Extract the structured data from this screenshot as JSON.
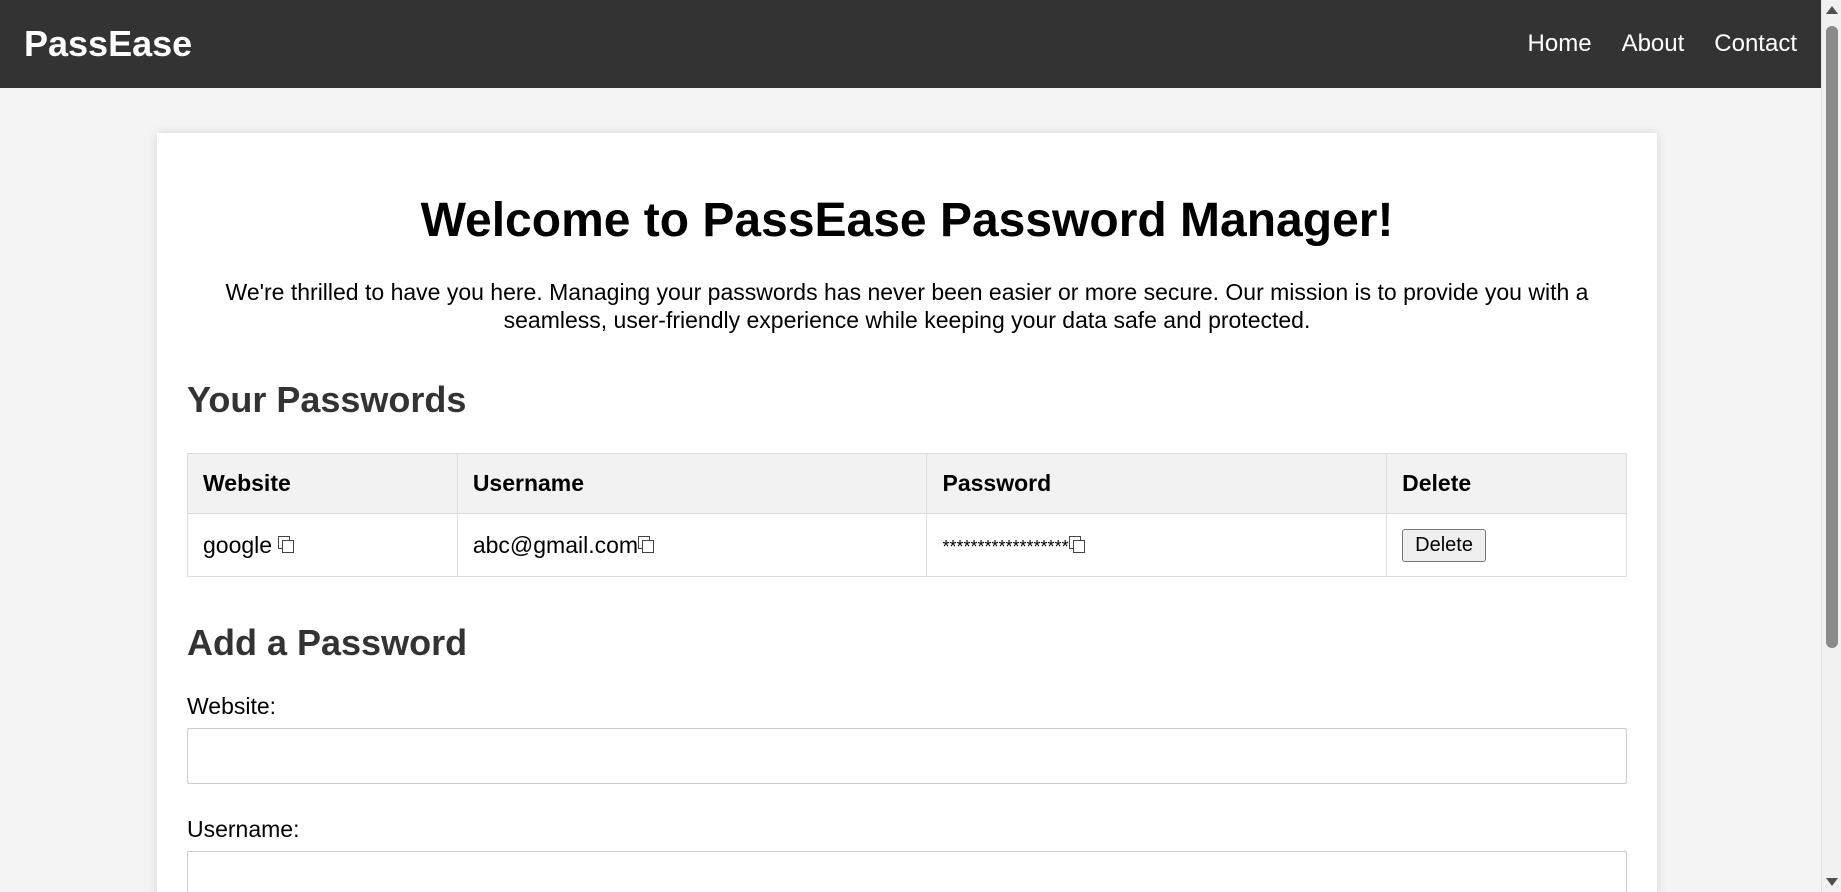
{
  "navbar": {
    "brand": "PassEase",
    "links": [
      "Home",
      "About",
      "Contact"
    ]
  },
  "welcome": {
    "title": "Welcome to PassEase Password Manager!",
    "text": "We're thrilled to have you here. Managing your passwords has never been easier or more secure. Our mission is to provide you with a seamless, user-friendly experience while keeping your data safe and protected."
  },
  "passwords": {
    "title": "Your Passwords",
    "columns": [
      "Website",
      "Username",
      "Password",
      "Delete"
    ],
    "rows": [
      {
        "website": "google",
        "username": "abc@gmail.com",
        "password": "******************",
        "delete_label": "Delete"
      }
    ]
  },
  "add_form": {
    "title": "Add a Password",
    "website_label": "Website:",
    "website_value": "",
    "username_label": "Username:",
    "username_value": ""
  },
  "colors": {
    "navbar_bg": "#333333",
    "page_bg": "#f4f4f4",
    "header_row_bg": "#f2f2f2"
  }
}
